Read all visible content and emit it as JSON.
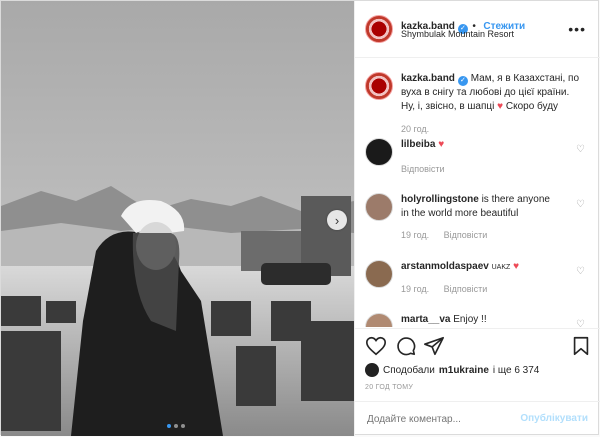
{
  "post": {
    "username": "kazka.band",
    "verified_icon": "verified-badge-icon",
    "follow_label": "Стежити",
    "location": "Shymbulak Mountain Resort",
    "more_icon": "more-options-icon",
    "caption": {
      "text_line1": "Мам, я в Казахстані, по",
      "text_line2": "вуха в снігу та любові до цієї країни.",
      "text_line3a": "Ну, і, звісно, в шапці",
      "text_line3b": "Скоро буду",
      "time": "20 год."
    },
    "comments": [
      {
        "username": "lilbeiba",
        "text": "",
        "time": "",
        "reply": "Відповісти",
        "has_heart": true
      },
      {
        "username": "holyrollingstone",
        "text_a": "is there anyone",
        "text_b": "in the world more beautiful",
        "time": "19 год.",
        "reply": "Відповісти"
      },
      {
        "username": "arstanmoldaspaev",
        "text": "UAKZ",
        "time": "19 год.",
        "reply": "Відповісти"
      },
      {
        "username": "marta__va",
        "text": "Enjoy !!"
      }
    ],
    "likes": {
      "prefix": "Сподобали",
      "user": "m1ukraine",
      "suffix": "і ще 6 374"
    },
    "timestamp": "20 ГОД ТОМУ",
    "add_comment_placeholder": "Додайте коментар...",
    "publish_label": "Опублікувати",
    "carousel": {
      "current": 1,
      "total": 3
    },
    "colors": {
      "accent": "#3897f0",
      "heart": "#ed4956",
      "muted": "#999999"
    }
  }
}
